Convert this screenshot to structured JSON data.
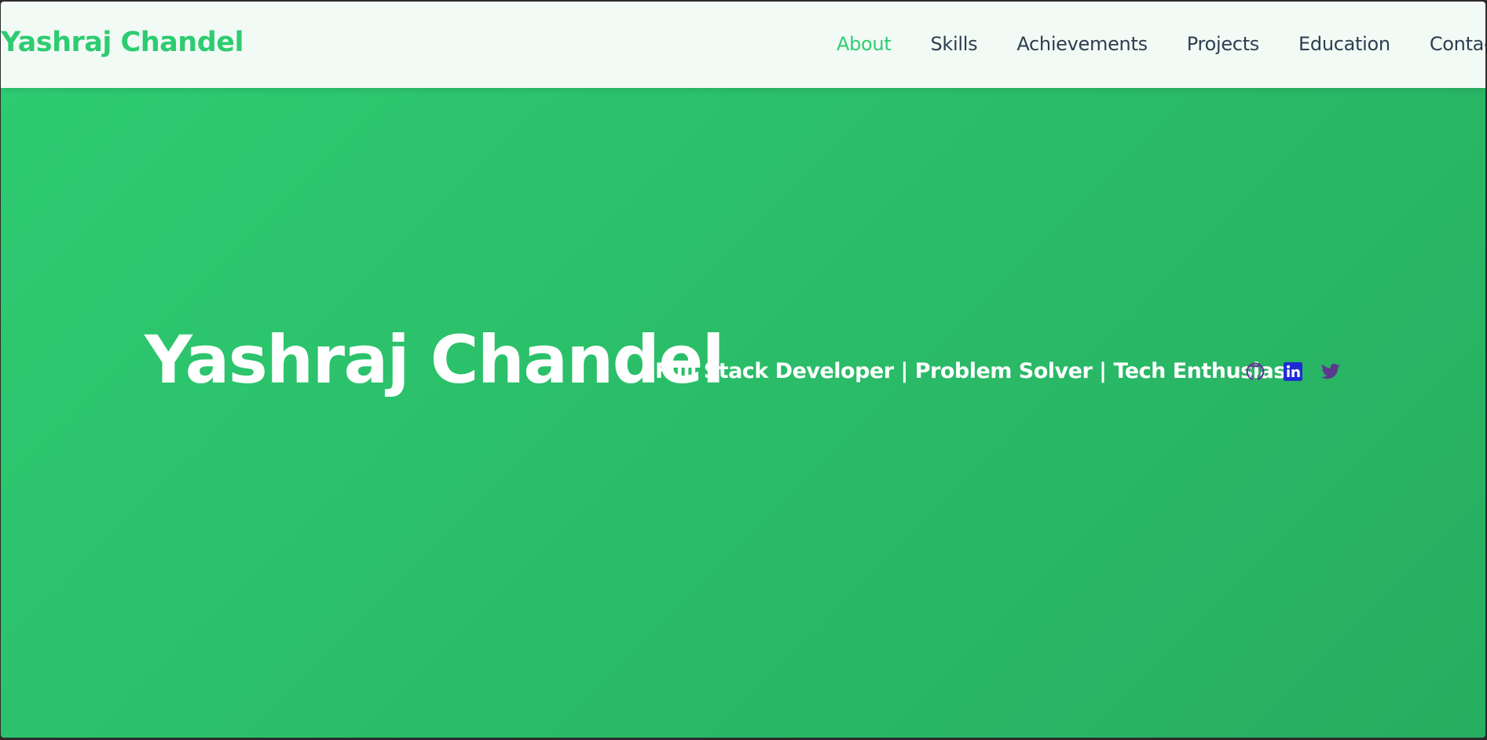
{
  "nav": {
    "brand": "Yashraj Chandel",
    "links": [
      "About",
      "Skills",
      "Achievements",
      "Projects",
      "Education",
      "Contact"
    ],
    "active": "About"
  },
  "hero": {
    "title": "Yashraj Chandel",
    "subtitle": "Full Stack Developer | Problem Solver | Tech Enthusiast"
  },
  "social": [
    {
      "icon": "github-icon",
      "color": "#5b3a8e"
    },
    {
      "icon": "linkedin-icon",
      "color": "#1e2ad6"
    },
    {
      "icon": "twitter-icon",
      "color": "#5b3a8e"
    }
  ],
  "colors": {
    "accent": "#2ecc71",
    "hero_gradient_start": "#2ecc71",
    "hero_gradient_end": "#27ae60",
    "nav_text": "#2c3e50",
    "nav_background": "#f2faf5"
  }
}
